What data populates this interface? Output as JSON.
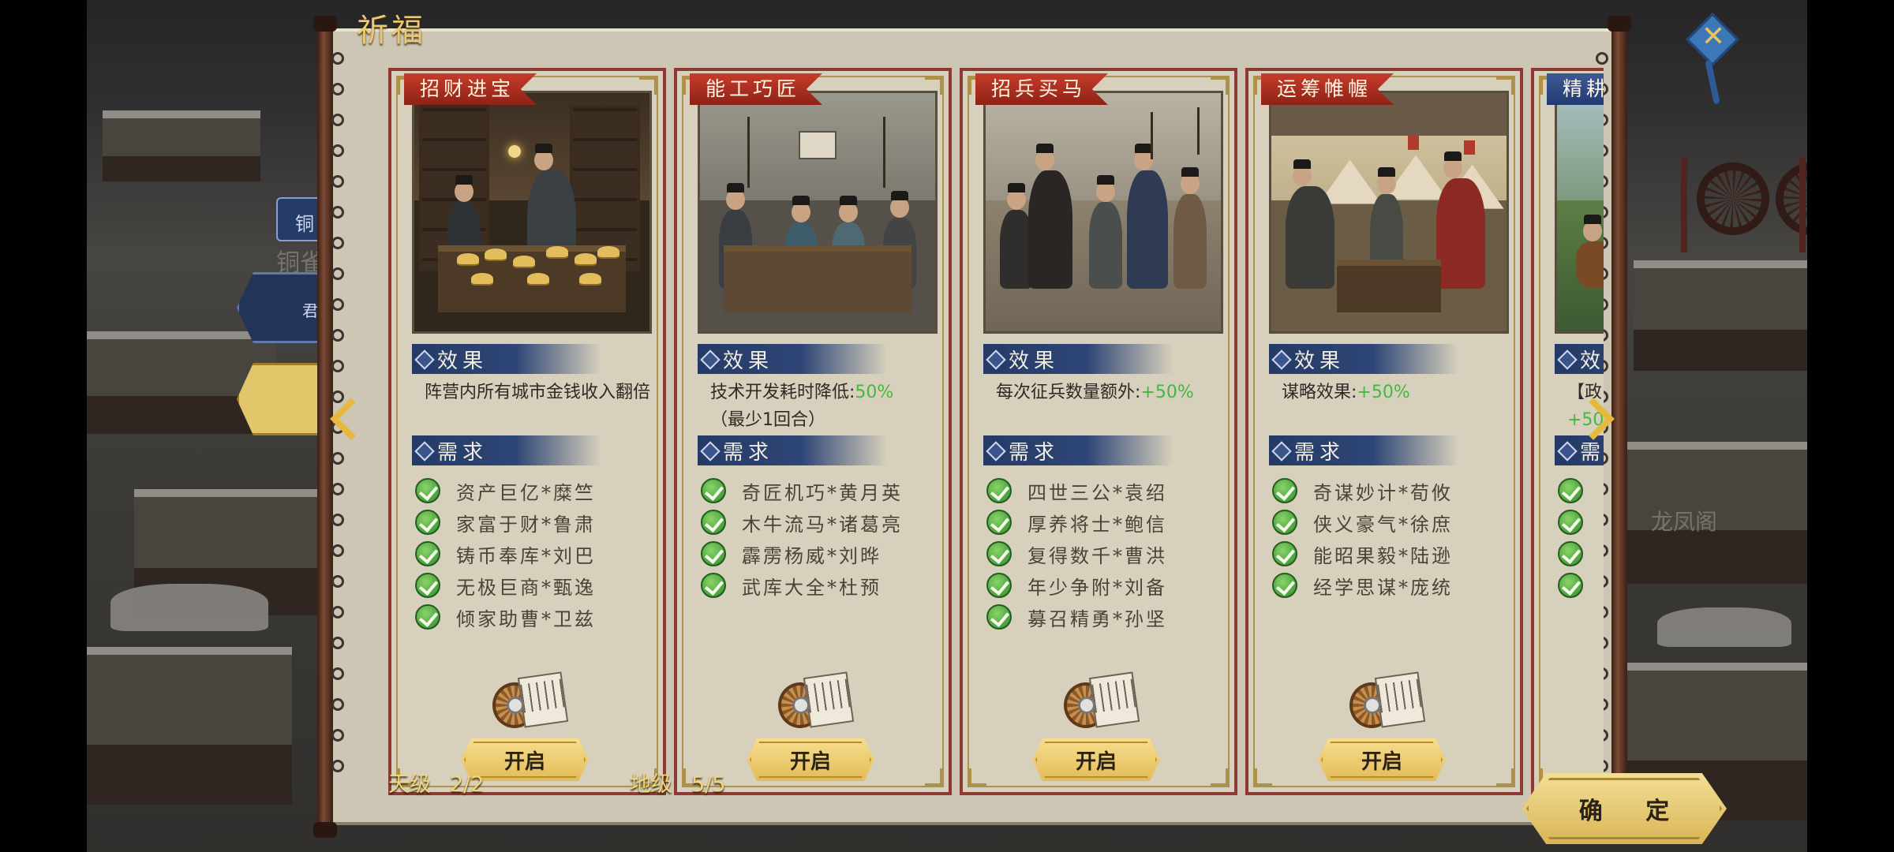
{
  "dialog": {
    "title": "祈福",
    "confirm_label": "确 定",
    "close_icon": "close-kite-icon"
  },
  "background": {
    "tab_top": "铜",
    "tab_second": "铜雀",
    "tab_third": "君",
    "building_label": "龙凤阁"
  },
  "cards": [
    {
      "name": "招财进宝",
      "effect_heading": "效果",
      "effect_text": "阵营内所有城市金钱收入翻倍",
      "effect_highlight": "",
      "effect_extra": "",
      "req_heading": "需求",
      "requirements": [
        "资产巨亿*糜竺",
        "家富于财*鲁肃",
        "铸币奉库*刘巴",
        "无极巨商*甄逸",
        "倾家助曹*卫兹"
      ],
      "button": "开启"
    },
    {
      "name": "能工巧匠",
      "effect_heading": "效果",
      "effect_text": "技术开发耗时降低:",
      "effect_highlight": "50%",
      "effect_extra": "（最少1回合）",
      "req_heading": "需求",
      "requirements": [
        "奇匠机巧*黄月英",
        "木牛流马*诸葛亮",
        "霹雳杨威*刘晔",
        "武库大全*杜预"
      ],
      "button": "开启"
    },
    {
      "name": "招兵买马",
      "effect_heading": "效果",
      "effect_text": "每次征兵数量额外:",
      "effect_highlight": "+50%",
      "effect_extra": "",
      "req_heading": "需求",
      "requirements": [
        "四世三公*袁绍",
        "厚养将士*鲍信",
        "复得数千*曹洪",
        "年少争附*刘备",
        "募召精勇*孙坚"
      ],
      "button": "开启"
    },
    {
      "name": "运筹帷幄",
      "effect_heading": "效果",
      "effect_text": "谋略效果:",
      "effect_highlight": "+50%",
      "effect_extra": "",
      "req_heading": "需求",
      "requirements": [
        "奇谋妙计*荀攸",
        "侠义豪气*徐庶",
        "能昭果毅*陆逊",
        "经学思谋*庞统"
      ],
      "button": "开启"
    },
    {
      "name": "精耕",
      "effect_heading": "效",
      "effect_text": "【政",
      "effect_highlight": "+50",
      "effect_extra": "",
      "req_heading": "需",
      "requirements": [
        "",
        "",
        "",
        ""
      ],
      "button": ""
    }
  ],
  "footer": {
    "tier1_label": "天级",
    "tier1_value": "2/2",
    "tier2_label": "地级",
    "tier2_value": "5/5"
  },
  "colors": {
    "ribbon_red": "#b8321f",
    "ribbon_blue": "#2f4a84",
    "highlight_green": "#44b840",
    "gold": "#e9c971"
  }
}
